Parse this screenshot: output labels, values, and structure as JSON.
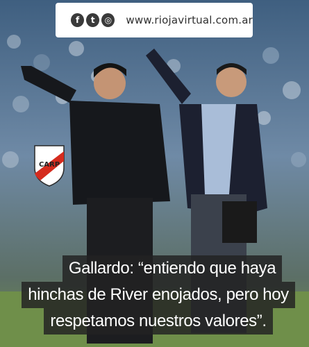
{
  "post": {
    "website": "www.riojavirtual.com.ar",
    "social_icons": [
      "facebook-icon",
      "twitter-icon",
      "instagram-icon"
    ],
    "social_glyphs": [
      "f",
      "t",
      "◎"
    ],
    "badge_text": "CARP",
    "caption_lines": [
      "Gallardo: “entiendo que haya",
      "hinchas de River enojados, pero hoy",
      "respetamos nuestros valores”."
    ]
  },
  "colors": {
    "badge_red": "#d52b1e",
    "caption_background": "#232323",
    "caption_text": "#ffffff",
    "pitch": "#6f8f4a"
  }
}
